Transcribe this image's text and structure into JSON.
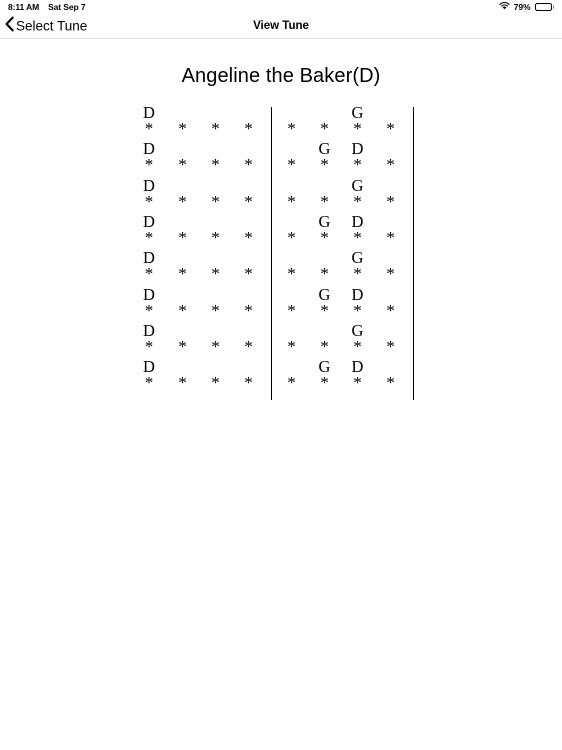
{
  "status_bar": {
    "time": "8:11 AM",
    "date": "Sat Sep 7",
    "battery_percent": "79%",
    "battery_level": 79,
    "wifi_icon": "wifi-icon",
    "battery_icon": "battery-icon"
  },
  "nav_bar": {
    "back_label": "Select Tune",
    "back_icon": "chevron-left-icon",
    "title": "View Tune"
  },
  "tune": {
    "title": "Angeline the Baker(D)",
    "beat_symbol": "*",
    "columns": 8,
    "measure_break_after_column": 4,
    "rows": [
      {
        "chords": [
          "D",
          "",
          "",
          "",
          "",
          "",
          "G",
          ""
        ],
        "beats": [
          "*",
          "*",
          "*",
          "*",
          "*",
          "*",
          "*",
          "*"
        ]
      },
      {
        "chords": [
          "D",
          "",
          "",
          "",
          "",
          "G",
          "D",
          ""
        ],
        "beats": [
          "*",
          "*",
          "*",
          "*",
          "*",
          "*",
          "*",
          "*"
        ]
      },
      {
        "chords": [
          "D",
          "",
          "",
          "",
          "",
          "",
          "G",
          ""
        ],
        "beats": [
          "*",
          "*",
          "*",
          "*",
          "*",
          "*",
          "*",
          "*"
        ]
      },
      {
        "chords": [
          "D",
          "",
          "",
          "",
          "",
          "G",
          "D",
          ""
        ],
        "beats": [
          "*",
          "*",
          "*",
          "*",
          "*",
          "*",
          "*",
          "*"
        ]
      },
      {
        "chords": [
          "D",
          "",
          "",
          "",
          "",
          "",
          "G",
          ""
        ],
        "beats": [
          "*",
          "*",
          "*",
          "*",
          "*",
          "*",
          "*",
          "*"
        ]
      },
      {
        "chords": [
          "D",
          "",
          "",
          "",
          "",
          "G",
          "D",
          ""
        ],
        "beats": [
          "*",
          "*",
          "*",
          "*",
          "*",
          "*",
          "*",
          "*"
        ]
      },
      {
        "chords": [
          "D",
          "",
          "",
          "",
          "",
          "",
          "G",
          ""
        ],
        "beats": [
          "*",
          "*",
          "*",
          "*",
          "*",
          "*",
          "*",
          "*"
        ]
      },
      {
        "chords": [
          "D",
          "",
          "",
          "",
          "",
          "G",
          "D",
          ""
        ],
        "beats": [
          "*",
          "*",
          "*",
          "*",
          "*",
          "*",
          "*",
          "*"
        ]
      }
    ]
  },
  "colors": {
    "text": "#000000",
    "background": "#ffffff",
    "separator": "#e2e2e5"
  }
}
